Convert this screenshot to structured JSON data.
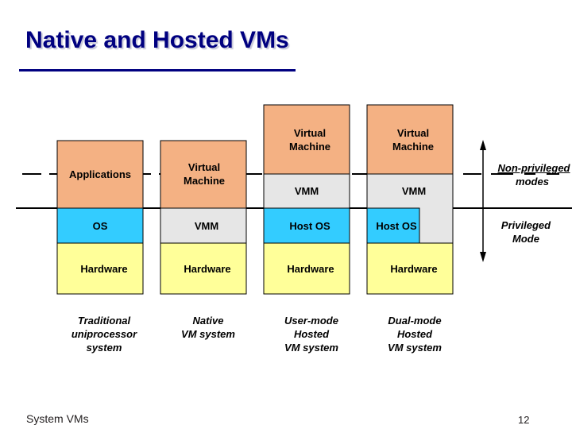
{
  "slide": {
    "title": "Native and Hosted VMs",
    "footer_left": "System VMs",
    "page_number": "12"
  },
  "colors": {
    "title": "#000080",
    "applications_vm": "#f4b183",
    "os": "#33ccff",
    "vmm": "#e6e6e6",
    "hardware": "#ffff99"
  },
  "columns": [
    {
      "name": "traditional",
      "layers": {
        "top": "Applications",
        "middle": "OS",
        "bottom": "Hardware"
      },
      "caption": [
        "Traditional",
        "uniprocessor",
        "system"
      ]
    },
    {
      "name": "native",
      "layers": {
        "top": "Virtual Machine",
        "middle": "VMM",
        "bottom": "Hardware"
      },
      "caption": [
        "Native",
        "VM system"
      ]
    },
    {
      "name": "user-mode-hosted",
      "layers": {
        "top": "Virtual Machine",
        "upper_middle": "VMM",
        "middle": "Host OS",
        "bottom": "Hardware"
      },
      "caption": [
        "User-mode",
        "Hosted",
        "VM system"
      ]
    },
    {
      "name": "dual-mode-hosted",
      "layers": {
        "top": "Virtual Machine",
        "upper_middle": "VMM",
        "middle": "Host OS",
        "bottom": "Hardware"
      },
      "caption": [
        "Dual-mode",
        "Hosted",
        "VM system"
      ]
    }
  ],
  "modes": {
    "non_privileged": [
      "Non-privileged",
      "modes"
    ],
    "privileged": [
      "Privileged",
      "Mode"
    ]
  }
}
